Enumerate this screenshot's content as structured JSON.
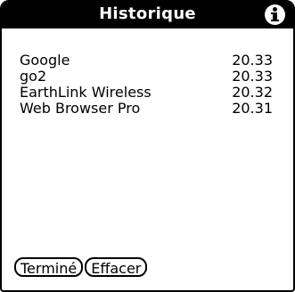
{
  "dialog": {
    "title": "Historique"
  },
  "history": {
    "items": [
      {
        "name": "Google",
        "time": "20.33"
      },
      {
        "name": "go2",
        "time": "20.33"
      },
      {
        "name": "EarthLink Wireless",
        "time": "20.32"
      },
      {
        "name": "Web Browser Pro",
        "time": "20.31"
      }
    ]
  },
  "buttons": {
    "done_label": "Terminé",
    "clear_label": "Effacer"
  },
  "icons": {
    "info": "info-icon"
  }
}
